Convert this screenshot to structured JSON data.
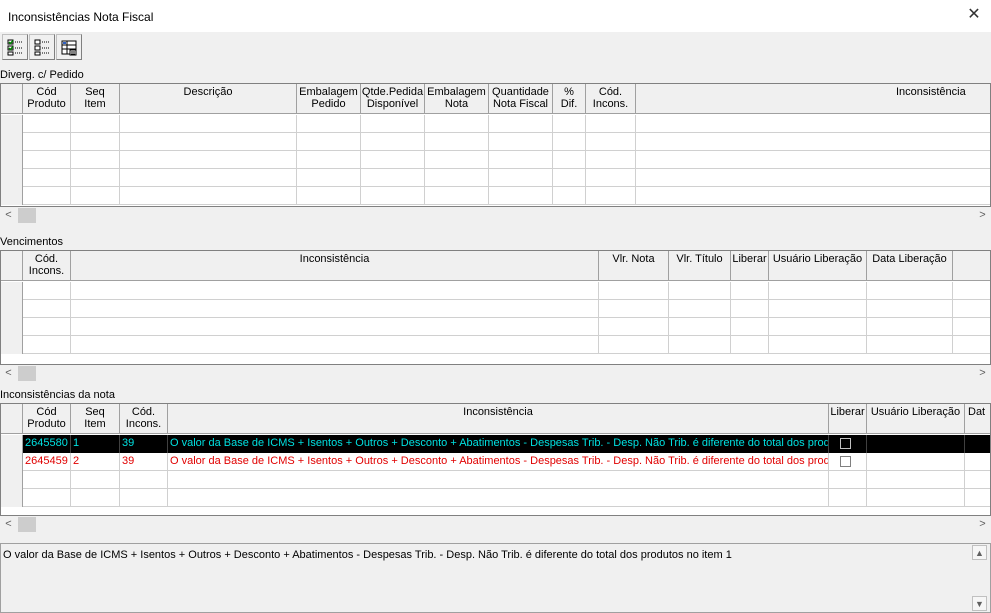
{
  "window": {
    "title": "Inconsistências Nota Fiscal",
    "close_symbol": "✕"
  },
  "toolbar": {
    "icons": [
      "check-list-icon",
      "tree-list-icon",
      "grid-icon"
    ]
  },
  "section1": {
    "label": "Diverg. c/ Pedido",
    "headers": [
      "Cód\nProduto",
      "Seq\nItem",
      "Descrição",
      "Embalagem\nPedido",
      "Qtde.Pedida\nDisponível",
      "Embalagem\nNota",
      "Quantidade\nNota Fiscal",
      "%\nDif.",
      "Cód.\nIncons.",
      "Inconsistência"
    ]
  },
  "section2": {
    "label": "Vencimentos",
    "headers": [
      "Cód.\nIncons.",
      "Inconsistência",
      "Vlr. Nota",
      "Vlr. Título",
      "Liberar",
      "Usuário Liberação",
      "Data Liberação"
    ]
  },
  "section3": {
    "label": "Inconsistências da nota",
    "headers": [
      "Cód\nProduto",
      "Seq\nItem",
      "Cód.\nIncons.",
      "Inconsistência",
      "Liberar",
      "Usuário Liberação",
      "Dat"
    ],
    "rows": [
      {
        "cod_produto": "2645580",
        "seq": "1",
        "cod_incons": "39",
        "inconsistencia": "O valor da Base de ICMS + Isentos + Outros + Desconto + Abatimentos - Despesas Trib. - Desp. Não Trib. é diferente do total dos produtos"
      },
      {
        "cod_produto": "2645459",
        "seq": "2",
        "cod_incons": "39",
        "inconsistencia": "O valor da Base de ICMS + Isentos + Outros + Desconto + Abatimentos - Despesas Trib. - Desp. Não Trib. é diferente do total dos produtos"
      }
    ]
  },
  "scroll": {
    "left": "<",
    "right": ">",
    "up": "▲",
    "down": "▼"
  },
  "message": "O valor da Base de ICMS + Isentos + Outros + Desconto + Abatimentos - Despesas Trib. - Desp. Não Trib. é diferente do total dos produtos no item 1"
}
